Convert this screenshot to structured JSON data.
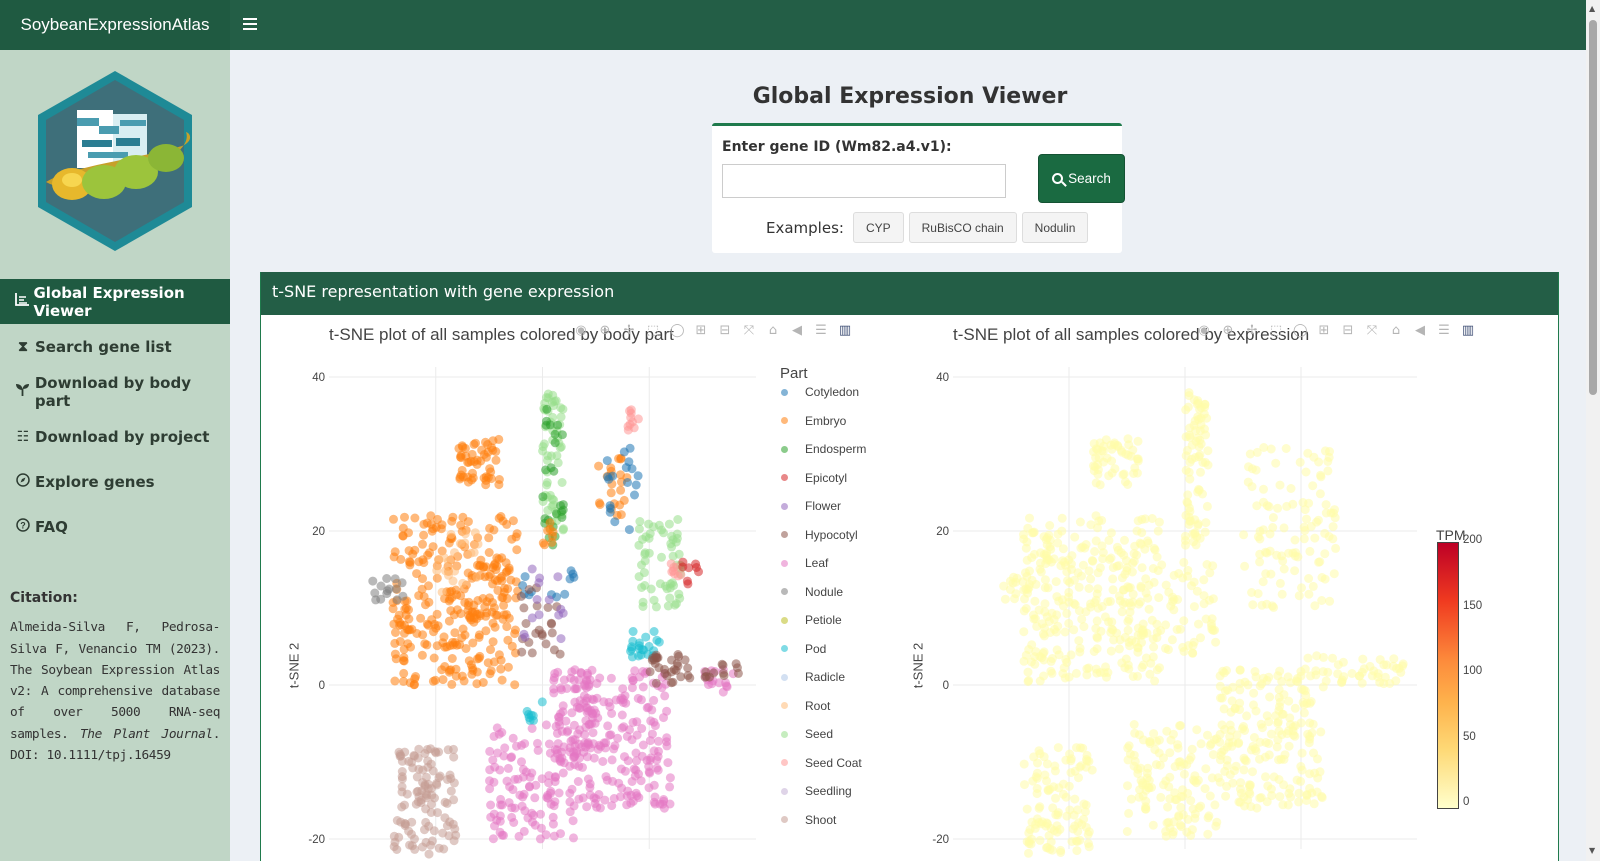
{
  "app": {
    "brand": "SoybeanExpressionAtlas"
  },
  "sidebar": {
    "items": [
      {
        "label": "Global Expression Viewer",
        "icon": "line-chart-icon",
        "active": true
      },
      {
        "label": "Search gene list",
        "icon": "hourglass-icon",
        "active": false
      },
      {
        "label": "Download by body part",
        "icon": "seedling-icon",
        "active": false
      },
      {
        "label": "Download by project",
        "icon": "list-check-icon",
        "active": false
      },
      {
        "label": "Explore genes",
        "icon": "compass-icon",
        "active": false
      },
      {
        "label": "FAQ",
        "icon": "question-circle-icon",
        "active": false
      }
    ],
    "citation": {
      "heading": "Citation:",
      "text": "Almeida-Silva F, Pedrosa-Silva F, Venancio TM (2023). The Soybean Expression Atlas v2: A comprehensive database of over 5000 RNA-seq samples.",
      "journal": "The Plant Journal",
      "doi": ". DOI: 10.1111/tpj.16459"
    }
  },
  "search": {
    "page_title": "Global Expression Viewer",
    "label": "Enter gene ID (Wm82.a4.v1):",
    "value": "",
    "button": "Search",
    "examples_label": "Examples:",
    "examples": [
      "CYP",
      "RuBisCO chain",
      "Nodulin"
    ]
  },
  "box": {
    "title": "t-SNE representation with gene expression"
  },
  "colors": {
    "accent": "#235e46",
    "sidebar": "#c0d6c6",
    "active": "#1f5a41"
  },
  "modebar_icons": [
    "camera-icon",
    "zoom-icon",
    "pan-icon",
    "box-select-icon",
    "lasso-icon",
    "zoom-in-icon",
    "zoom-out-icon",
    "autoscale-icon",
    "home-icon",
    "hover-closest-icon",
    "hover-compare-icon",
    "plotly-logo-icon"
  ],
  "chart_data": [
    {
      "type": "scatter",
      "title": "t-SNE plot of all samples colored by body part",
      "ylabel": "t-SNE 2",
      "xlabel": "",
      "y_ticks": [
        40,
        20,
        0,
        -20
      ],
      "grid": true,
      "legend_title": "Part",
      "legend_position": "right",
      "series": [
        {
          "name": "Cotyledon",
          "color": "#1f77b4"
        },
        {
          "name": "Embryo",
          "color": "#ff7f0e"
        },
        {
          "name": "Endosperm",
          "color": "#2ca02c"
        },
        {
          "name": "Epicotyl",
          "color": "#d62728"
        },
        {
          "name": "Flower",
          "color": "#9467bd"
        },
        {
          "name": "Hypocotyl",
          "color": "#8c564b"
        },
        {
          "name": "Leaf",
          "color": "#e377c2"
        },
        {
          "name": "Nodule",
          "color": "#7f7f7f"
        },
        {
          "name": "Petiole",
          "color": "#bcbd22"
        },
        {
          "name": "Pod",
          "color": "#17becf"
        },
        {
          "name": "Radicle",
          "color": "#aec7e8"
        },
        {
          "name": "Root",
          "color": "#ffbb78"
        },
        {
          "name": "Seed",
          "color": "#98df8a"
        },
        {
          "name": "Seed Coat",
          "color": "#ff9896"
        },
        {
          "name": "Seedling",
          "color": "#c5b0d5"
        },
        {
          "name": "Shoot",
          "color": "#c49c94"
        }
      ],
      "clusters": [
        {
          "part": "Embryo",
          "x": [
            -14,
            -2
          ],
          "y": [
            0,
            22
          ],
          "n": 260
        },
        {
          "part": "Embryo",
          "x": [
            -8,
            -4
          ],
          "y": [
            26,
            32
          ],
          "n": 50
        },
        {
          "part": "Embryo",
          "x": [
            -7,
            -3
          ],
          "y": [
            8,
            16
          ],
          "n": 40
        },
        {
          "part": "Nodule",
          "x": [
            -16,
            -13
          ],
          "y": [
            11,
            14
          ],
          "n": 14
        },
        {
          "part": "Seed",
          "x": [
            0,
            2
          ],
          "y": [
            20,
            38
          ],
          "n": 55
        },
        {
          "part": "Seed",
          "x": [
            9,
            13
          ],
          "y": [
            10,
            22
          ],
          "n": 55
        },
        {
          "part": "Endosperm",
          "x": [
            0,
            2
          ],
          "y": [
            18,
            37
          ],
          "n": 25
        },
        {
          "part": "Embryo",
          "x": [
            0,
            1
          ],
          "y": [
            18,
            22
          ],
          "n": 8
        },
        {
          "part": "Embryo",
          "x": [
            5,
            8
          ],
          "y": [
            22,
            30
          ],
          "n": 22
        },
        {
          "part": "Cotyledon",
          "x": [
            6,
            9
          ],
          "y": [
            20,
            31
          ],
          "n": 18
        },
        {
          "part": "Seed Coat",
          "x": [
            8,
            9
          ],
          "y": [
            33,
            36
          ],
          "n": 10
        },
        {
          "part": "Seed Coat",
          "x": [
            12,
            13
          ],
          "y": [
            14,
            16
          ],
          "n": 8
        },
        {
          "part": "Cotyledon",
          "x": [
            -2,
            3
          ],
          "y": [
            11,
            15
          ],
          "n": 12
        },
        {
          "part": "Hypocotyl",
          "x": [
            -2,
            2
          ],
          "y": [
            4,
            13
          ],
          "n": 22
        },
        {
          "part": "Flower",
          "x": [
            -2,
            2
          ],
          "y": [
            6,
            16
          ],
          "n": 14
        },
        {
          "part": "Pod",
          "x": [
            8,
            11
          ],
          "y": [
            3,
            7
          ],
          "n": 22
        },
        {
          "part": "Pod",
          "x": [
            -2,
            0
          ],
          "y": [
            -5,
            -2
          ],
          "n": 8
        },
        {
          "part": "Leaf",
          "x": [
            3,
            12
          ],
          "y": [
            -16,
            2
          ],
          "n": 180
        },
        {
          "part": "Leaf",
          "x": [
            -5,
            3
          ],
          "y": [
            -20,
            -5
          ],
          "n": 120
        },
        {
          "part": "Leaf",
          "x": [
            1,
            5
          ],
          "y": [
            -10,
            2
          ],
          "n": 70
        },
        {
          "part": "Leaf",
          "x": [
            15,
            18
          ],
          "y": [
            -1,
            2
          ],
          "n": 16
        },
        {
          "part": "Shoot",
          "x": [
            -14,
            -8
          ],
          "y": [
            -22,
            -8
          ],
          "n": 110
        },
        {
          "part": "Hypocotyl",
          "x": [
            10,
            14
          ],
          "y": [
            0,
            4
          ],
          "n": 30
        },
        {
          "part": "Hypocotyl",
          "x": [
            15,
            19
          ],
          "y": [
            1,
            3
          ],
          "n": 12
        },
        {
          "part": "Root",
          "x": [
            -10,
            -6
          ],
          "y": [
            12,
            20
          ],
          "n": 20
        },
        {
          "part": "Epicotyl",
          "x": [
            13,
            15
          ],
          "y": [
            13,
            17
          ],
          "n": 8
        }
      ]
    },
    {
      "type": "scatter",
      "title": "t-SNE plot of all samples colored by expression",
      "ylabel": "t-SNE 2",
      "xlabel": "",
      "y_ticks": [
        40,
        20,
        0,
        -20
      ],
      "grid": true,
      "colorbar": {
        "title": "TPM",
        "ticks": [
          200,
          150,
          100,
          50,
          0
        ],
        "range": [
          0,
          200
        ]
      },
      "point_color": "#fffca8",
      "clusters": [
        {
          "x": [
            -14,
            -2
          ],
          "y": [
            0,
            22
          ],
          "n": 320
        },
        {
          "x": [
            -8,
            -4
          ],
          "y": [
            26,
            32
          ],
          "n": 50
        },
        {
          "x": [
            -16,
            -13
          ],
          "y": [
            11,
            14
          ],
          "n": 14
        },
        {
          "x": [
            0,
            2
          ],
          "y": [
            18,
            38
          ],
          "n": 80
        },
        {
          "x": [
            5,
            13
          ],
          "y": [
            10,
            31
          ],
          "n": 110
        },
        {
          "x": [
            -2,
            3
          ],
          "y": [
            4,
            16
          ],
          "n": 50
        },
        {
          "x": [
            3,
            12
          ],
          "y": [
            -16,
            2
          ],
          "n": 200
        },
        {
          "x": [
            -5,
            3
          ],
          "y": [
            -20,
            -5
          ],
          "n": 130
        },
        {
          "x": [
            -14,
            -8
          ],
          "y": [
            -22,
            -8
          ],
          "n": 110
        },
        {
          "x": [
            10,
            19
          ],
          "y": [
            0,
            4
          ],
          "n": 45
        }
      ]
    }
  ]
}
